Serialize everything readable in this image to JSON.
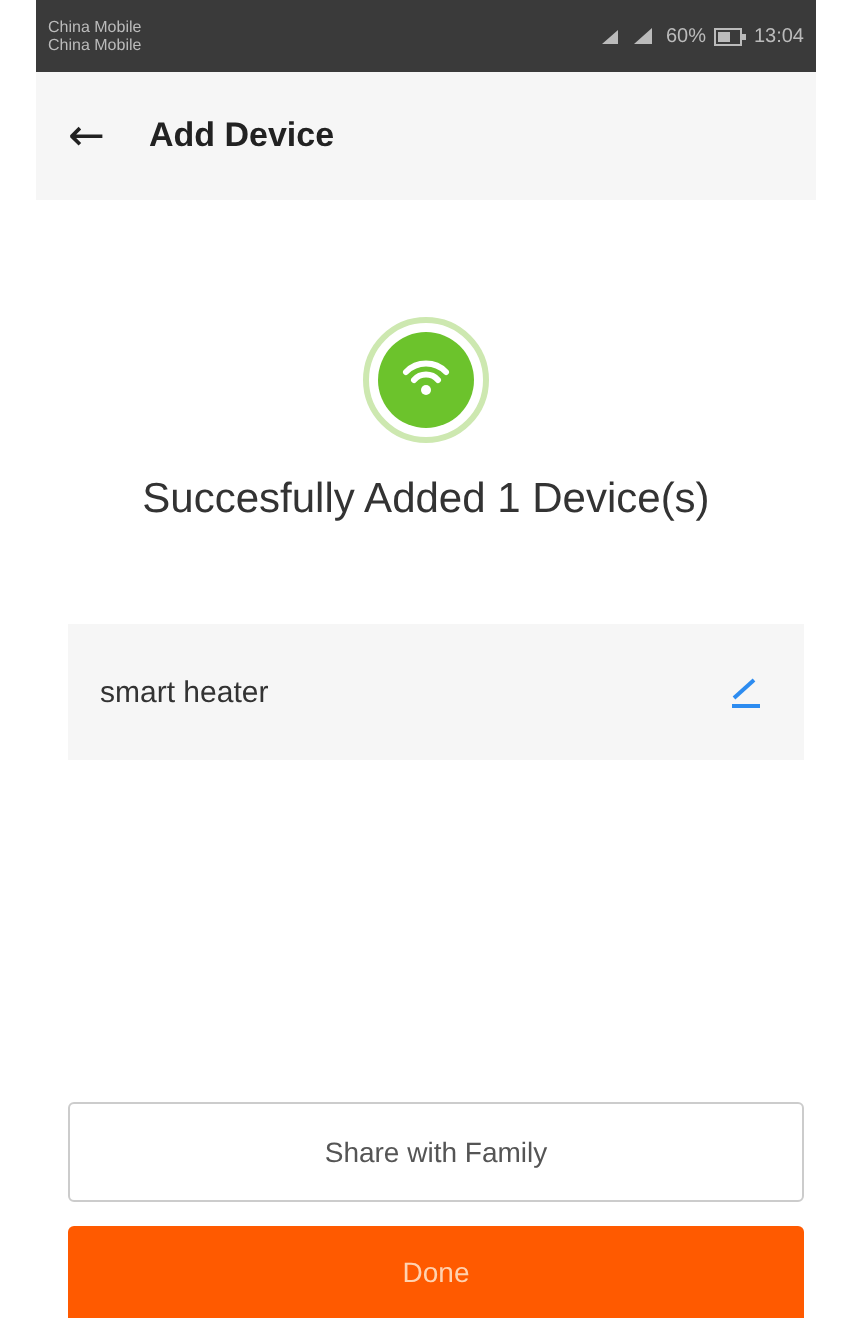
{
  "status_bar": {
    "carriers": [
      "China Mobile",
      "China Mobile"
    ],
    "battery": "60%",
    "time": "13:04"
  },
  "header": {
    "back_icon": "←",
    "title": "Add Device"
  },
  "result": {
    "message": "Succesfully Added 1 Device(s)"
  },
  "devices": [
    {
      "name": "smart heater"
    }
  ],
  "buttons": [
    {
      "kind": "outline",
      "label": "Share with Family"
    },
    {
      "kind": "primary",
      "label": "Done"
    }
  ]
}
